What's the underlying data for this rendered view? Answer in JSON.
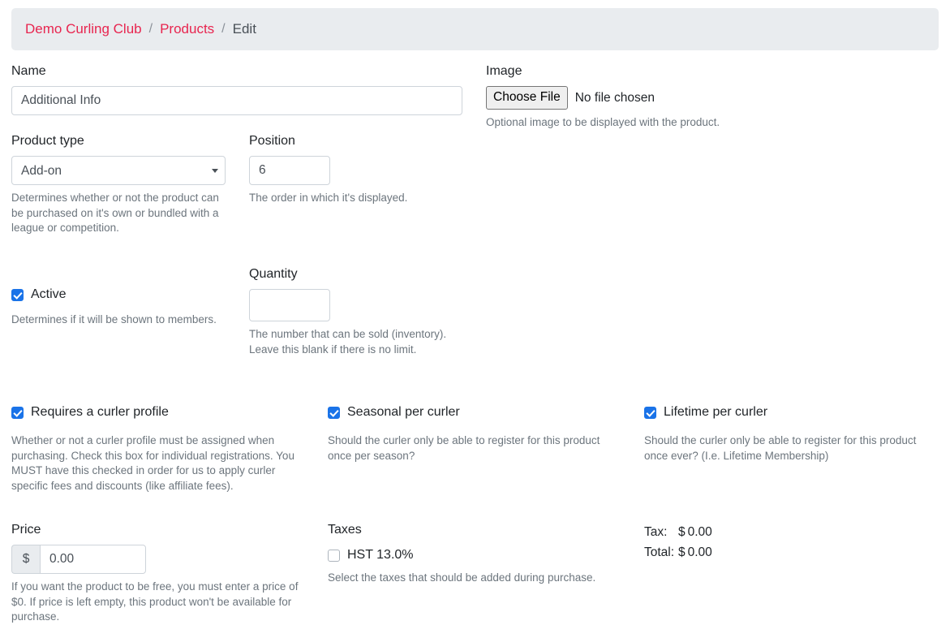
{
  "breadcrumb": {
    "org": "Demo Curling Club",
    "section": "Products",
    "current": "Edit",
    "separator": "/",
    "link_color": "#e8254f"
  },
  "form": {
    "name": {
      "label": "Name",
      "value": "Additional Info",
      "placeholder": ""
    },
    "image": {
      "label": "Image",
      "button_label": "Choose File",
      "file_status": "No file chosen",
      "help": "Optional image to be displayed with the product."
    },
    "product_type": {
      "label": "Product type",
      "value": "Add-on",
      "options": [
        "Add-on"
      ],
      "help": "Determines whether or not the product can be purchased on it's own or bundled with a league or competition."
    },
    "position": {
      "label": "Position",
      "value": "6",
      "help": "The order in which it's displayed."
    },
    "active": {
      "label": "Active",
      "checked": true,
      "help": "Determines if it will be shown to members."
    },
    "quantity": {
      "label": "Quantity",
      "value": "",
      "help_line1": "The number that can be sold (inventory).",
      "help_line2": "Leave this blank if there is no limit."
    },
    "requires_curler_profile": {
      "label": "Requires a curler profile",
      "checked": true,
      "help": "Whether or not a curler profile must be assigned when purchasing. Check this box for individual registrations. You MUST have this checked in order for us to apply curler specific fees and discounts (like affiliate fees)."
    },
    "seasonal_per_curler": {
      "label": "Seasonal per curler",
      "checked": true,
      "help": "Should the curler only be able to register for this product once per season?"
    },
    "lifetime_per_curler": {
      "label": "Lifetime per curler",
      "checked": true,
      "help": "Should the curler only be able to register for this product once ever? (I.e. Lifetime Membership)"
    },
    "price": {
      "label": "Price",
      "currency_symbol": "$",
      "value": "0.00",
      "help": "If you want the product to be free, you must enter a price of $0. If price is left empty, this product won't be available for purchase."
    },
    "taxes": {
      "label": "Taxes",
      "items": [
        {
          "label": "HST 13.0%",
          "checked": false
        }
      ],
      "help": "Select the taxes that should be added during purchase."
    },
    "totals": {
      "tax_label": "Tax:",
      "tax_currency": "$",
      "tax_value": "0.00",
      "total_label": "Total:",
      "total_currency": "$",
      "total_value": "0.00"
    }
  }
}
